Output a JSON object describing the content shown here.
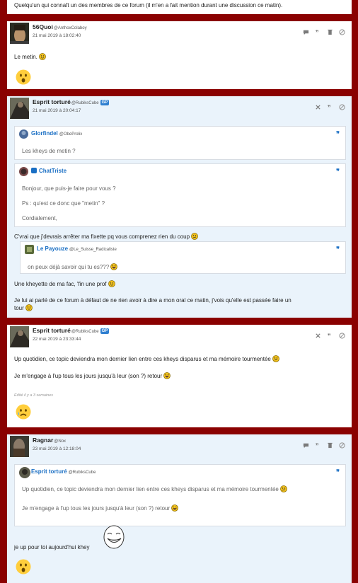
{
  "top_text": "Quelqu'un qui connaît un des membres de ce forum (il m'en a fait mention durant une discussion ce matin).",
  "posts": [
    {
      "author": "56Quoi",
      "handle": "@AnthoxColaboy",
      "date": "21 mai 2019 à 18:02:40",
      "text": "Le metin."
    },
    {
      "author": "Esprit torturé",
      "handle": "@RubiksCube",
      "badge": "GP",
      "date": "21 mai 2019 à 20:04:17",
      "quote1": {
        "author": "Glorfindel",
        "handle": "@ObeProlix",
        "text": "Les kheys de metin ?"
      },
      "quote2": {
        "author": "ChatTriste",
        "lines": [
          "Bonjour, que puis-je faire pour vous ?",
          "Ps : qu'est ce donc que \"metin\" ?",
          "Cordialement,"
        ]
      },
      "text1": "C'vrai que j'devrais arrêter ma fixette pq vous comprenez rien du coup",
      "quote3": {
        "author": "Le Payouze",
        "handle": "@Le_Suisse_Radicaliste",
        "text": "on peux déjà savoir qui tu es???"
      },
      "text2": "Une kheyette de ma fac, 'fin une prof",
      "text3a": "Je lui ai parlé de ce forum à défaut de ne rien avoir à dire a mon oral ce matin, j'vois qu'elle est passée faire un",
      "text3b": "tour"
    },
    {
      "author": "Esprit torturé",
      "handle": "@RubiksCube",
      "badge": "GP",
      "date": "22 mai 2019 à 23:33:44",
      "text1": "Up quotidien, ce topic deviendra mon dernier lien entre ces kheys disparus et ma mémoire tourmentée",
      "text2": "Je m'engage à l'up tous les jours jusqu'à leur (son ?) retour",
      "edited": "Edité il y a 3 semaines"
    },
    {
      "author": "Ragnar",
      "handle": "@Nox",
      "date": "23 mai 2019 à 12:18:04",
      "quote": {
        "author": "Esprit torturé",
        "handle": "@RubiksCube",
        "text1": "Up quotidien, ce topic deviendra mon dernier lien entre ces kheys disparus et ma mémoire tourmentée",
        "text2": "Je m'engage à l'up tous les jours jusqu'à leur (son ?) retour"
      },
      "text": "je up pour toi aujourd'hui khey"
    }
  ],
  "quote_mark": "❞",
  "colors": {
    "background": "#8a0101",
    "link": "#1a6fc4",
    "highlight": "#eaf3fb"
  }
}
